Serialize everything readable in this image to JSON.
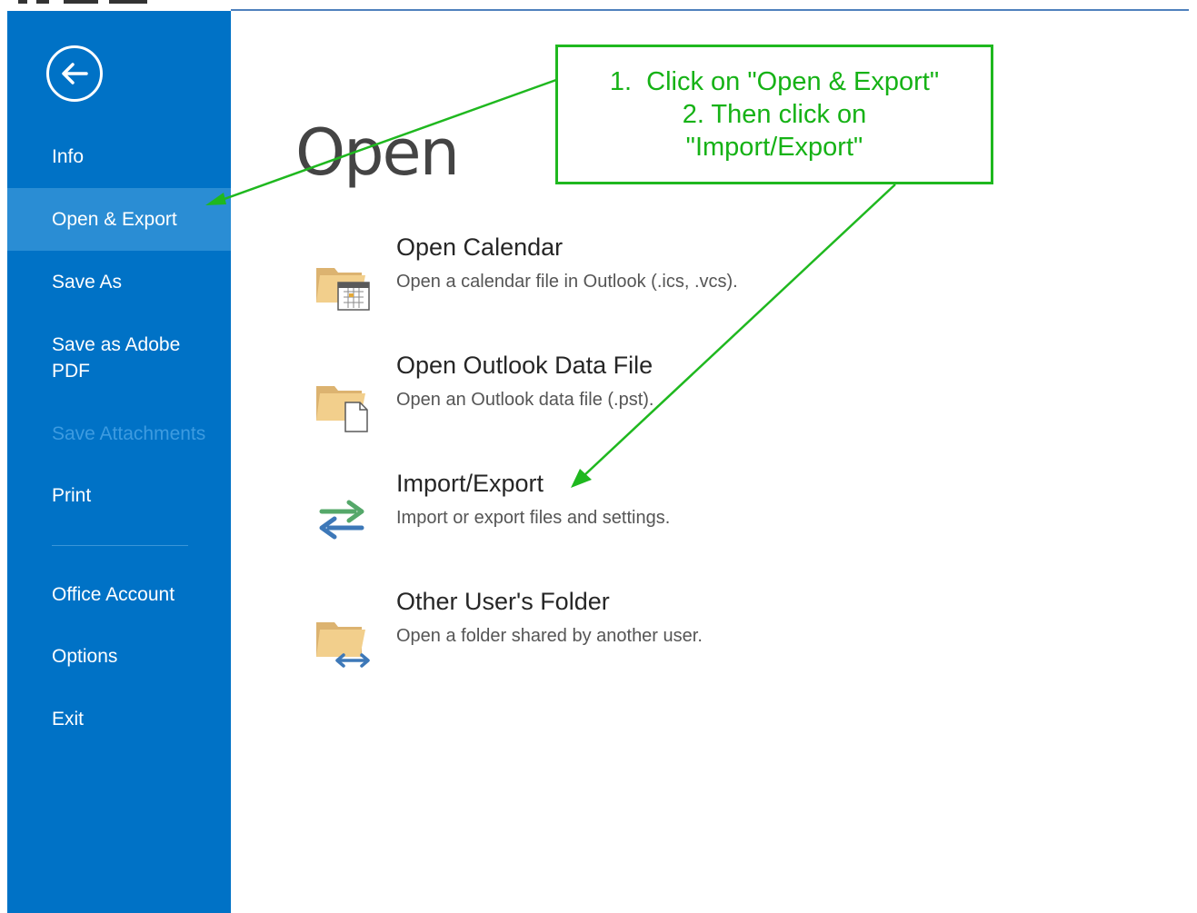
{
  "colors": {
    "sidebar_bg": "#0072c6",
    "sidebar_selected": "#2a8dd4",
    "sidebar_disabled_text": "#3d9be0",
    "annotation_green": "#1fb81f"
  },
  "sidebar": {
    "back_icon": "back-arrow-circle-icon",
    "items": [
      {
        "label": "Info"
      },
      {
        "label": "Open & Export",
        "selected": true
      },
      {
        "label": "Save As"
      },
      {
        "label": "Save as Adobe PDF"
      },
      {
        "label": "Save Attachments",
        "disabled": true
      },
      {
        "label": "Print"
      },
      {
        "label": "Office Account"
      },
      {
        "label": "Options"
      },
      {
        "label": "Exit"
      }
    ]
  },
  "main": {
    "title": "Open",
    "options": [
      {
        "title": "Open Calendar",
        "description": "Open a calendar file in Outlook (.ics, .vcs).",
        "icon": "folder-calendar-icon"
      },
      {
        "title": "Open Outlook Data File",
        "description": "Open an Outlook data file (.pst).",
        "icon": "folder-document-icon"
      },
      {
        "title": "Import/Export",
        "description": "Import or export files and settings.",
        "icon": "import-export-arrows-icon"
      },
      {
        "title": "Other User's Folder",
        "description": "Open a folder shared by another user.",
        "icon": "folder-shared-icon"
      }
    ]
  },
  "annotation": {
    "line1": "1.  Click on \"Open & Export\"",
    "line2": "2. Then click on",
    "line3": "\"Import/Export\""
  }
}
